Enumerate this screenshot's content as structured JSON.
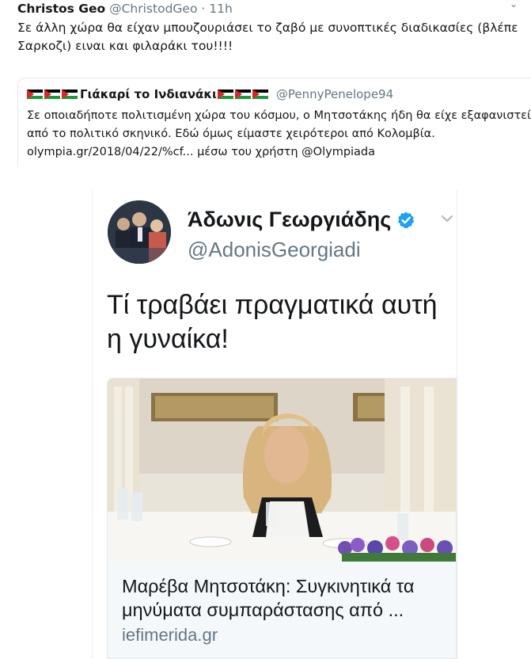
{
  "outer_tweet": {
    "display_name": "Christos Geo",
    "handle_time": "@ChristodGeo · 11h",
    "text": "Σε άλλη χώρα θα είχαν μπουζουριάσει το ζαβό με συνοπτικές διαδικασίες (βλέπε Σαρκοζι) ειναι και φιλαράκι του!!!!"
  },
  "quoted_tweet": {
    "display_name": "Γιάκαρί το Ινδιανάκι",
    "handle": "@PennyPenelope94",
    "text": "Σε οποιαδήποτε πολιτισμένη χώρα του κόσμου, ο Μητσοτάκης ήδη θα είχε εξαφανιστεί από το πολιτικό σκηνικό. Εδώ όμως είμαστε χειρότεροι από Κολομβία. olympia.gr/2018/04/22/%cf... μέσω του χρήστη @Olympiada",
    "flag_colors": {
      "black": "#000000",
      "white": "#ffffff",
      "green": "#1a9a3c",
      "red": "#e0222a"
    }
  },
  "embedded_card": {
    "display_name": "Άδωνις Γεωργιάδης",
    "handle": "@AdonisGeorgiadi",
    "tweet_text": "Τί τραβάει πραγματικά αυτή η γυναίκα!",
    "link_title": "Μαρέβα Μητσοτάκη: Συγκινητικά τα μηνύματα συμπαράστασης από ...",
    "link_domain": "iefimerida.gr",
    "verified_color": "#1da1f2"
  },
  "icons": [
    "caret-down-icon",
    "palestine-flag-icon",
    "verified-badge-icon",
    "chevron-down-icon"
  ]
}
